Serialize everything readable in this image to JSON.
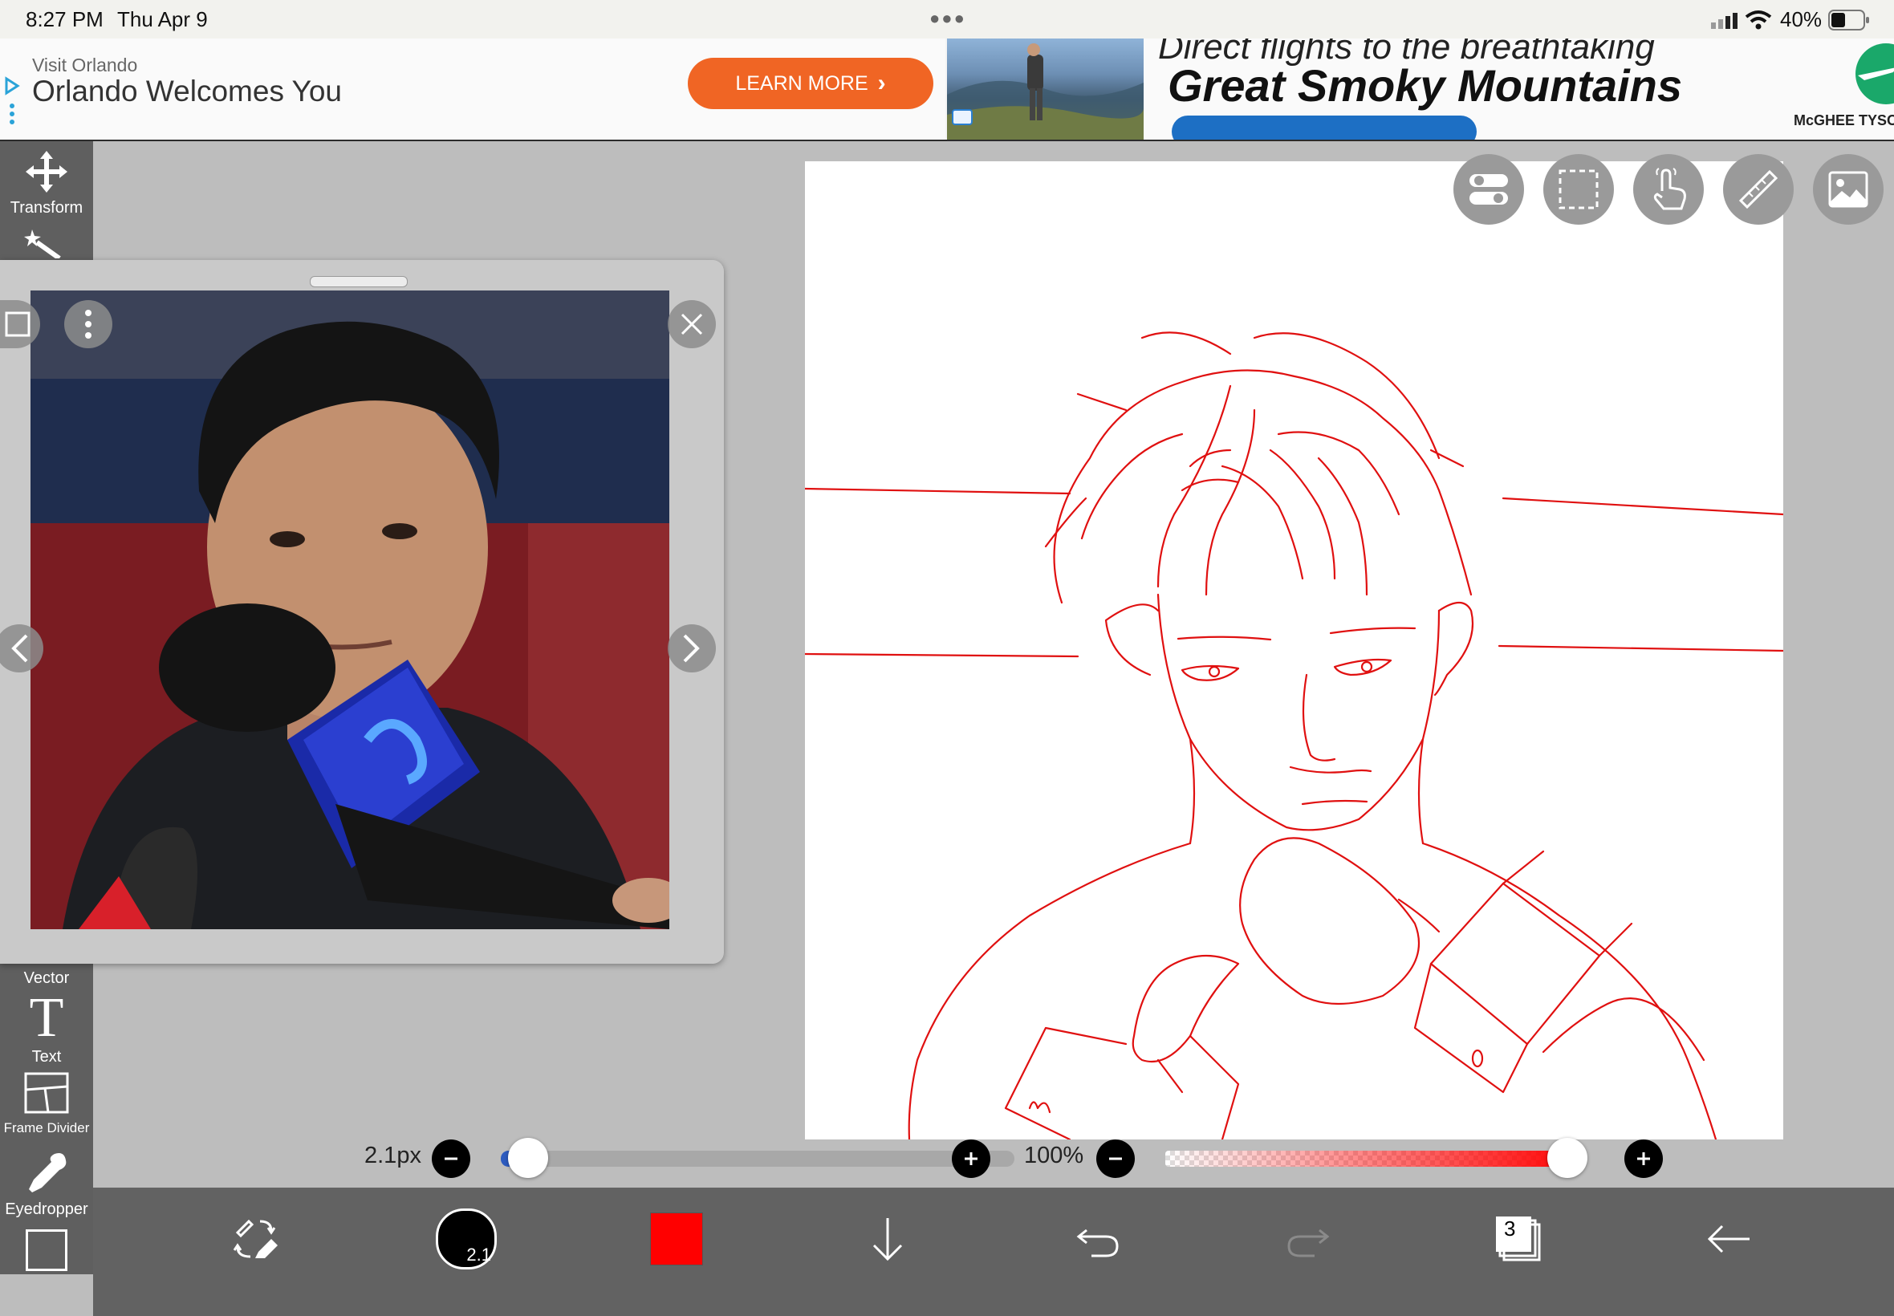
{
  "status_bar": {
    "time": "8:27 PM",
    "date": "Thu Apr 9",
    "battery": "40%"
  },
  "ad": {
    "sponsor": "Visit Orlando",
    "headline": "Orlando Welcomes You",
    "button": "LEARN MORE",
    "right_tagline": "Direct flights to the breathtaking",
    "right_headline": "Great Smoky Mountains",
    "right_brand": "McGHEE TYSON"
  },
  "toolbar": {
    "transform": "Transform",
    "vector": "Vector",
    "text": "Text",
    "frame_divider": "Frame Divider",
    "eyedropper": "Eyedropper"
  },
  "brush": {
    "size_label": "2.1px",
    "size_value": 2.1,
    "size_fraction": 0.02,
    "button_label": "2.1"
  },
  "opacity": {
    "label": "100%",
    "value_fraction": 1.0
  },
  "colors": {
    "brush": "#ff0000",
    "accent_orange": "#f06524",
    "toolbar": "#5f5f5f"
  },
  "layers": {
    "count": "3"
  },
  "icons": {
    "canvas_overlays": [
      "toggle-icon",
      "selection-icon",
      "hand-icon",
      "ruler-icon",
      "image-icon"
    ],
    "bottom": [
      "brush-swap-icon",
      "brush-size-icon",
      "color-swatch",
      "download-icon",
      "undo-icon",
      "redo-icon",
      "layers-icon",
      "back-arrow-icon"
    ]
  }
}
